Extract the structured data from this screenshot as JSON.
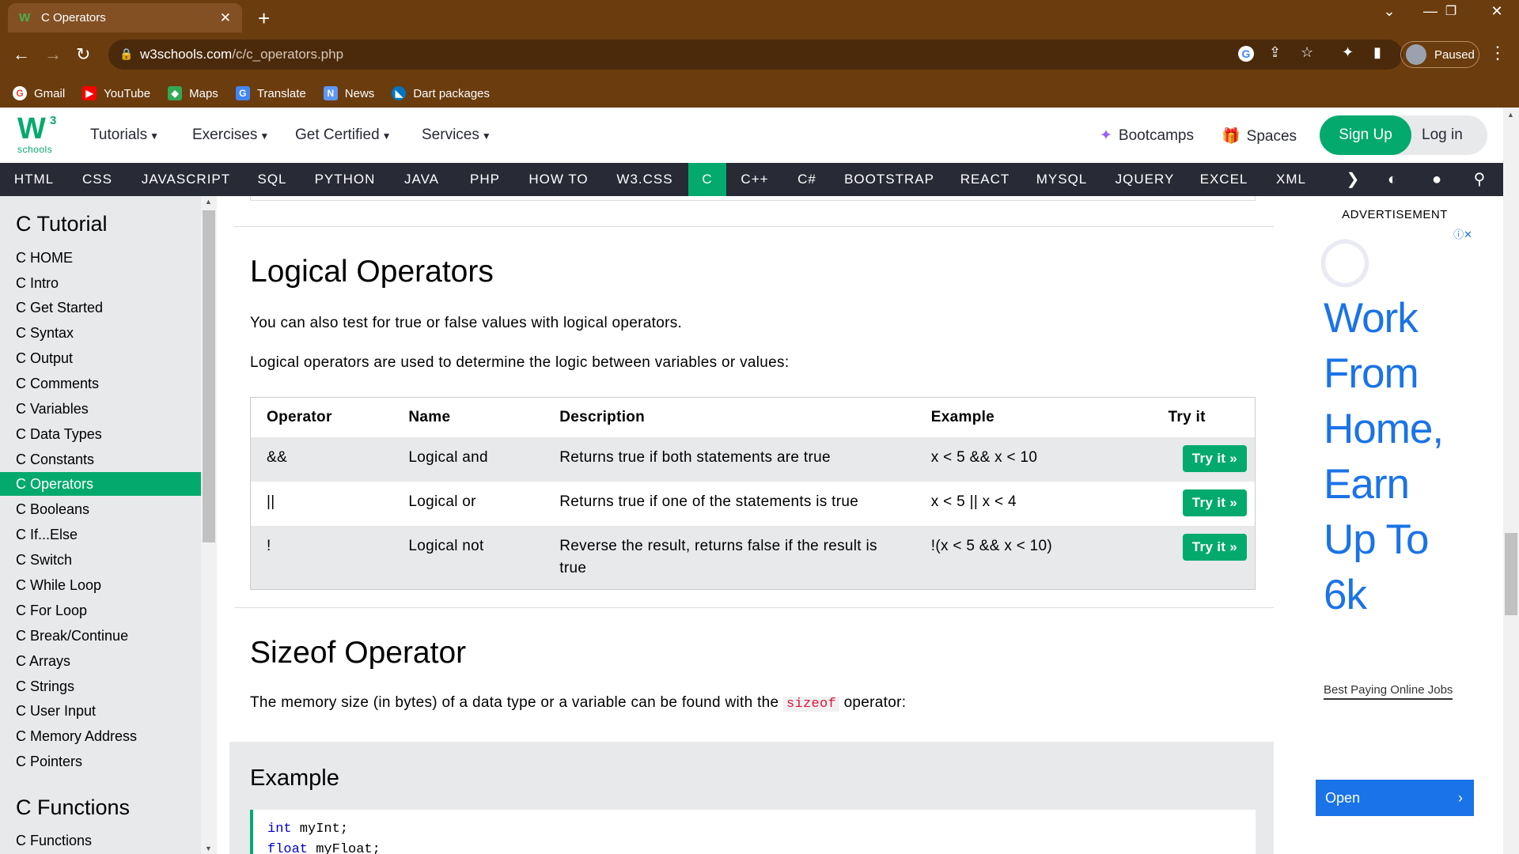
{
  "browser": {
    "tab_title": "C Operators",
    "url_domain": "w3schools.com",
    "url_path": "/c/c_operators.php",
    "profile_label": "Paused",
    "bookmarks": [
      "Gmail",
      "YouTube",
      "Maps",
      "Translate",
      "News",
      "Dart packages"
    ]
  },
  "header": {
    "logo_w": "W",
    "logo_3": "3",
    "logo_schools": "schools",
    "menus": [
      "Tutorials",
      "Exercises",
      "Get Certified",
      "Services"
    ],
    "bootcamps": "Bootcamps",
    "spaces": "Spaces",
    "signup": "Sign Up",
    "login": "Log in"
  },
  "topnav": {
    "items": [
      "HTML",
      "CSS",
      "JAVASCRIPT",
      "SQL",
      "PYTHON",
      "JAVA",
      "PHP",
      "HOW TO",
      "W3.CSS",
      "C",
      "C++",
      "C#",
      "BOOTSTRAP",
      "REACT",
      "MYSQL",
      "JQUERY",
      "EXCEL",
      "XML"
    ],
    "active": "C"
  },
  "sidebar": {
    "heading1": "C Tutorial",
    "items": [
      "C HOME",
      "C Intro",
      "C Get Started",
      "C Syntax",
      "C Output",
      "C Comments",
      "C Variables",
      "C Data Types",
      "C Constants",
      "C Operators",
      "C Booleans",
      "C If...Else",
      "C Switch",
      "C While Loop",
      "C For Loop",
      "C Break/Continue",
      "C Arrays",
      "C Strings",
      "C User Input",
      "C Memory Address",
      "C Pointers"
    ],
    "active": "C Operators",
    "heading2": "C Functions",
    "items2": [
      "C Functions"
    ]
  },
  "main": {
    "logical_title": "Logical Operators",
    "logical_p1": "You can also test for true or false values with logical operators.",
    "logical_p2": "Logical operators are used to determine the logic between variables or values:",
    "table": {
      "headers": [
        "Operator",
        "Name",
        "Description",
        "Example",
        "Try it"
      ],
      "rows": [
        {
          "op": "&&",
          "name": "Logical and",
          "desc": "Returns true if both statements are true",
          "example": "x < 5 &&  x < 10",
          "try": "Try it »"
        },
        {
          "op": "||",
          "name": "Logical or",
          "desc": "Returns true if one of the statements is true",
          "example": "x < 5 || x < 4",
          "try": "Try it »"
        },
        {
          "op": "!",
          "name": "Logical not",
          "desc": "Reverse the result, returns false if the result is true",
          "example": "!(x < 5 && x < 10)",
          "try": "Try it »"
        }
      ]
    },
    "sizeof_title": "Sizeof Operator",
    "sizeof_p_before": "The memory size (in bytes) of a data type or a variable can be found with the ",
    "sizeof_kw": "sizeof",
    "sizeof_p_after": " operator:",
    "example_title": "Example",
    "code": [
      {
        "kw": "int",
        "rest": " myInt;"
      },
      {
        "kw": "float",
        "rest": " myFloat;"
      }
    ]
  },
  "ad": {
    "label": "ADVERTISEMENT",
    "headline_lines": [
      "Work",
      "From",
      "Home,",
      "Earn",
      "Up To",
      "6k"
    ],
    "sub": "Best Paying Online Jobs",
    "open": "Open"
  },
  "colors": {
    "brand_green": "#04aa6d",
    "topnav_bg": "#282a35",
    "sidebar_bg": "#e7e9eb",
    "chrome_bg": "#6b3c0e",
    "ad_blue": "#1a73e8"
  }
}
